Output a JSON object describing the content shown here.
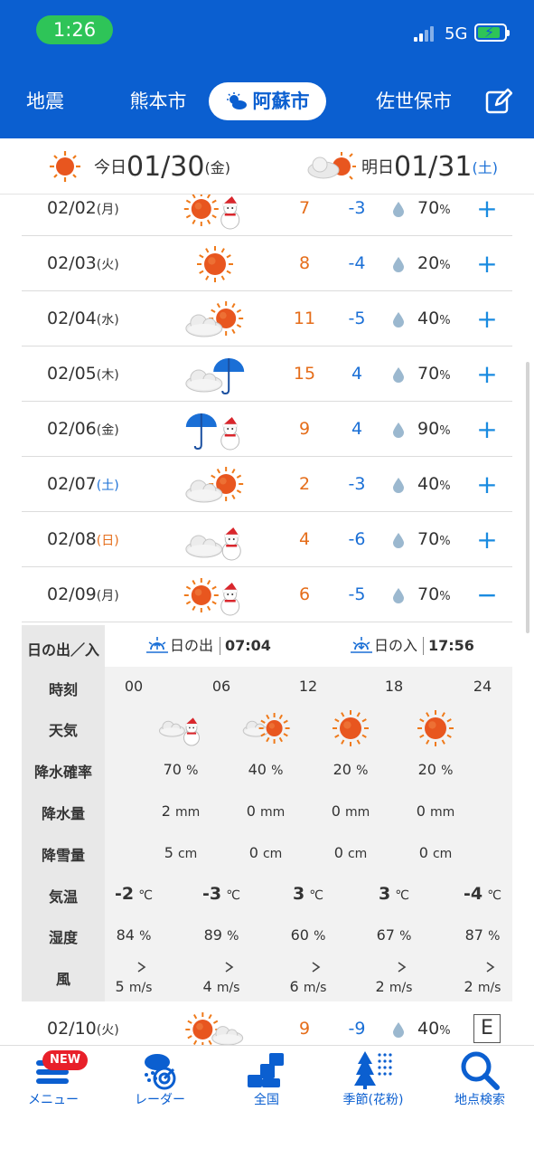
{
  "status": {
    "time": "1:26",
    "network": "5G"
  },
  "tabs": [
    {
      "label": "地震",
      "active": false
    },
    {
      "label": "熊本市",
      "active": false
    },
    {
      "label": "阿蘇市",
      "active": true,
      "icon": "partly-sunny-icon"
    },
    {
      "label": "佐世保市",
      "active": false
    }
  ],
  "datebar": {
    "today_prefix": "今日",
    "today_date": "01/30",
    "today_dow": "(金)",
    "tomorrow_prefix": "明日",
    "tomorrow_date": "01/31",
    "tomorrow_dow": "(土)"
  },
  "days": [
    {
      "date": "02/02",
      "dow": "(月)",
      "icons": [
        "sun",
        "snowman"
      ],
      "hi": "7",
      "lo": "-3",
      "pop": "70",
      "unit": "%",
      "toggle": "+"
    },
    {
      "date": "02/03",
      "dow": "(火)",
      "icons": [
        "sun"
      ],
      "hi": "8",
      "lo": "-4",
      "pop": "20",
      "unit": "%",
      "toggle": "+"
    },
    {
      "date": "02/04",
      "dow": "(水)",
      "icons": [
        "cloud",
        "sun"
      ],
      "hi": "11",
      "lo": "-5",
      "pop": "40",
      "unit": "%",
      "toggle": "+"
    },
    {
      "date": "02/05",
      "dow": "(木)",
      "icons": [
        "cloud",
        "umbrella"
      ],
      "hi": "15",
      "lo": "4",
      "pop": "70",
      "unit": "%",
      "toggle": "+"
    },
    {
      "date": "02/06",
      "dow": "(金)",
      "icons": [
        "umbrella",
        "snowman"
      ],
      "hi": "9",
      "lo": "4",
      "pop": "90",
      "unit": "%",
      "toggle": "+"
    },
    {
      "date": "02/07",
      "dow": "(土)",
      "icons": [
        "cloud",
        "sun"
      ],
      "hi": "2",
      "lo": "-3",
      "pop": "40",
      "unit": "%",
      "toggle": "+"
    },
    {
      "date": "02/08",
      "dow": "(日)",
      "icons": [
        "cloud",
        "snowman"
      ],
      "hi": "4",
      "lo": "-6",
      "pop": "70",
      "unit": "%",
      "toggle": "+"
    },
    {
      "date": "02/09",
      "dow": "(月)",
      "icons": [
        "sun",
        "snowman"
      ],
      "hi": "6",
      "lo": "-5",
      "pop": "70",
      "unit": "%",
      "toggle": "−"
    }
  ],
  "detail": {
    "sun_label": "日の出／入",
    "sunrise_label": "日の出",
    "sunrise_time": "07:04",
    "sunset_label": "日の入",
    "sunset_time": "17:56",
    "row_labels": [
      "時刻",
      "天気",
      "降水確率",
      "降水量",
      "降雪量",
      "気温",
      "湿度",
      "風"
    ],
    "hours": [
      "00",
      "06",
      "12",
      "18",
      "24"
    ],
    "weather": [
      "cloud-snow",
      "cloud-sun",
      "sun",
      "sun"
    ],
    "pop": [
      {
        "v": "70",
        "u": "%"
      },
      {
        "v": "40",
        "u": "%"
      },
      {
        "v": "20",
        "u": "%"
      },
      {
        "v": "20",
        "u": "%"
      }
    ],
    "rain": [
      {
        "v": "2",
        "u": "mm"
      },
      {
        "v": "0",
        "u": "mm"
      },
      {
        "v": "0",
        "u": "mm"
      },
      {
        "v": "0",
        "u": "mm"
      }
    ],
    "snow": [
      {
        "v": "5",
        "u": "cm"
      },
      {
        "v": "0",
        "u": "cm"
      },
      {
        "v": "0",
        "u": "cm"
      },
      {
        "v": "0",
        "u": "cm"
      }
    ],
    "temp": [
      {
        "v": "-2",
        "u": "℃"
      },
      {
        "v": "-3",
        "u": "℃"
      },
      {
        "v": "3",
        "u": "℃"
      },
      {
        "v": "3",
        "u": "℃"
      },
      {
        "v": "-4",
        "u": "℃"
      }
    ],
    "humidity": [
      {
        "v": "84",
        "u": "%"
      },
      {
        "v": "89",
        "u": "%"
      },
      {
        "v": "60",
        "u": "%"
      },
      {
        "v": "67",
        "u": "%"
      },
      {
        "v": "87",
        "u": "%"
      }
    ],
    "wind": [
      {
        "v": "5",
        "u": "m/s"
      },
      {
        "v": "4",
        "u": "m/s"
      },
      {
        "v": "6",
        "u": "m/s"
      },
      {
        "v": "2",
        "u": "m/s"
      },
      {
        "v": "2",
        "u": "m/s"
      }
    ]
  },
  "next_day": {
    "date": "02/10",
    "dow": "(火)",
    "icons": [
      "sun",
      "cloud"
    ],
    "hi": "9",
    "lo": "-9",
    "pop": "40",
    "unit": "%",
    "box": "E"
  },
  "nav": [
    {
      "label": "メニュー",
      "icon": "menu-icon",
      "badge": "NEW"
    },
    {
      "label": "レーダー",
      "icon": "radar-icon"
    },
    {
      "label": "全国",
      "icon": "japan-map-icon"
    },
    {
      "label": "季節(花粉)",
      "icon": "pollen-icon"
    },
    {
      "label": "地点検索",
      "icon": "search-icon"
    }
  ],
  "colors": {
    "brand": "#0b5fd0",
    "high": "#e56d1a",
    "low": "#1a6fd6"
  }
}
